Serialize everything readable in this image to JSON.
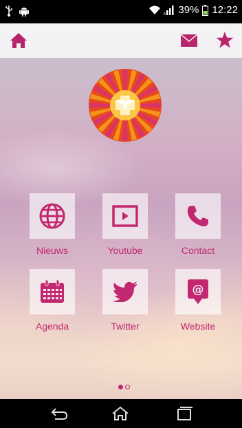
{
  "status": {
    "battery": "39%",
    "time": "12:22",
    "icons": [
      "usb-icon",
      "android-icon",
      "wifi-icon",
      "signal-icon",
      "battery-icon"
    ]
  },
  "topbar": {
    "icons": [
      "home-icon",
      "mail-icon",
      "star-icon"
    ]
  },
  "tiles": [
    {
      "label": "Nieuws",
      "icon": "globe-icon"
    },
    {
      "label": "Youtube",
      "icon": "play-icon"
    },
    {
      "label": "Contact",
      "icon": "phone-icon"
    },
    {
      "label": "Agenda",
      "icon": "calendar-icon"
    },
    {
      "label": "Twitter",
      "icon": "twitter-bird-icon"
    },
    {
      "label": "Website",
      "icon": "at-sign-icon"
    }
  ],
  "pager": {
    "pages": 2,
    "current": 1
  },
  "navbar": {
    "icons": [
      "back-icon",
      "home-outline-icon",
      "recents-icon"
    ]
  },
  "colors": {
    "accent": "#c2286f",
    "statusbar": "#000000"
  }
}
